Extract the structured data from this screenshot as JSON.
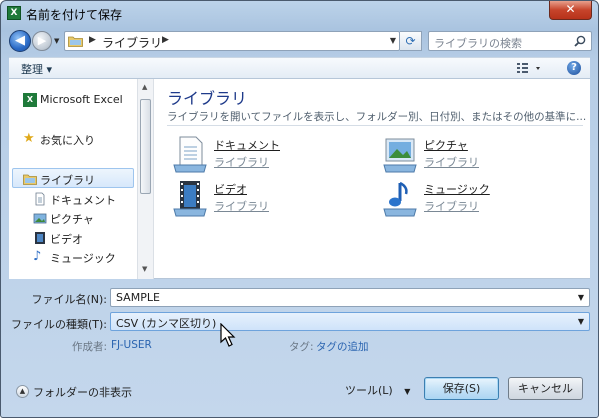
{
  "window": {
    "title": "名前を付けて保存",
    "app_icon": "excel-icon",
    "close_label": "✕"
  },
  "address": {
    "path": "ライブラリ",
    "search_placeholder": "ライブラリの検索"
  },
  "toolbar": {
    "organize": "整理 ▾"
  },
  "nav": {
    "items": [
      {
        "label": "Microsoft Excel",
        "icon": "excel-icon"
      },
      {
        "label": "お気に入り",
        "icon": "star-icon"
      },
      {
        "label": "ライブラリ",
        "icon": "library-icon",
        "selected": true
      },
      {
        "label": "ドキュメント",
        "icon": "document-icon"
      },
      {
        "label": "ピクチャ",
        "icon": "picture-icon"
      },
      {
        "label": "ビデオ",
        "icon": "video-icon"
      },
      {
        "label": "ミュージック",
        "icon": "music-icon"
      }
    ]
  },
  "content": {
    "title": "ライブラリ",
    "description": "ライブラリを開いてファイルを表示し、フォルダー別、日付別、またはその他の基準に...",
    "libraries": [
      {
        "name": "ドキュメント",
        "sub": "ライブラリ",
        "icon": "documents-library-icon"
      },
      {
        "name": "ピクチャ",
        "sub": "ライブラリ",
        "icon": "pictures-library-icon"
      },
      {
        "name": "ビデオ",
        "sub": "ライブラリ",
        "icon": "videos-library-icon"
      },
      {
        "name": "ミュージック",
        "sub": "ライブラリ",
        "icon": "music-library-icon"
      }
    ]
  },
  "form": {
    "filename_label": "ファイル名(N):",
    "filename_value": "SAMPLE",
    "filetype_label": "ファイルの種類(T):",
    "filetype_value": "CSV (カンマ区切り)",
    "author_label": "作成者:",
    "author_value": "FJ-USER",
    "tags_label": "タグ:",
    "tags_value": "タグの追加"
  },
  "footer": {
    "hide_folders": "フォルダーの非表示",
    "tools": "ツール(L)",
    "save": "保存(S)",
    "cancel": "キャンセル"
  },
  "colors": {
    "link": "#2a64b0",
    "heading": "#1e3a8a",
    "selection": "#cfe3fa"
  }
}
